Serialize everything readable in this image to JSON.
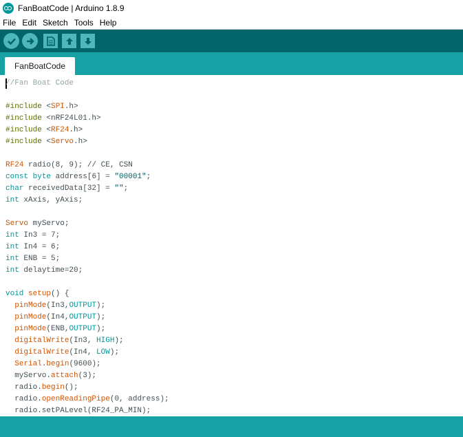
{
  "window": {
    "title": "FanBoatCode | Arduino 1.8.9"
  },
  "menu": [
    "File",
    "Edit",
    "Sketch",
    "Tools",
    "Help"
  ],
  "toolbar": {
    "buttons": [
      "verify",
      "upload",
      "new",
      "open",
      "save"
    ]
  },
  "tabs": [
    {
      "label": "FanBoatCode"
    }
  ],
  "editor": {
    "lines": [
      [
        [
          "//Fan Boat Code",
          "cmt"
        ]
      ],
      [],
      [
        [
          "#include",
          "inc"
        ],
        [
          " <",
          ""
        ],
        [
          "SPI",
          "fn"
        ],
        [
          ".h>",
          ""
        ]
      ],
      [
        [
          "#include",
          "inc"
        ],
        [
          " <nRF24L01.h>",
          ""
        ]
      ],
      [
        [
          "#include",
          "inc"
        ],
        [
          " <",
          ""
        ],
        [
          "RF24",
          "fn"
        ],
        [
          ".h>",
          ""
        ]
      ],
      [
        [
          "#include",
          "inc"
        ],
        [
          " <",
          ""
        ],
        [
          "Servo",
          "fn"
        ],
        [
          ".h>",
          ""
        ]
      ],
      [],
      [
        [
          "RF24",
          "fn"
        ],
        [
          " radio(8, 9); // CE, CSN",
          ""
        ]
      ],
      [
        [
          "const",
          "type"
        ],
        [
          " ",
          ""
        ],
        [
          "byte",
          "type"
        ],
        [
          " address[6] = ",
          ""
        ],
        [
          "\"00001\"",
          "str"
        ],
        [
          ";",
          ""
        ]
      ],
      [
        [
          "char",
          "type"
        ],
        [
          " receivedData[32] = ",
          ""
        ],
        [
          "\"\"",
          "str"
        ],
        [
          ";",
          ""
        ]
      ],
      [
        [
          "int",
          "type"
        ],
        [
          " xAxis, yAxis;",
          ""
        ]
      ],
      [],
      [
        [
          "Servo",
          "fn"
        ],
        [
          " myServo;",
          ""
        ]
      ],
      [
        [
          "int",
          "type"
        ],
        [
          " In3 = 7;",
          ""
        ]
      ],
      [
        [
          "int",
          "type"
        ],
        [
          " In4 = 6;",
          ""
        ]
      ],
      [
        [
          "int",
          "type"
        ],
        [
          " ENB = 5;",
          ""
        ]
      ],
      [
        [
          "int",
          "type"
        ],
        [
          " delaytime=20;",
          ""
        ]
      ],
      [],
      [
        [
          "void",
          "type"
        ],
        [
          " ",
          ""
        ],
        [
          "setup",
          "fn"
        ],
        [
          "() {",
          ""
        ]
      ],
      [
        [
          "  ",
          ""
        ],
        [
          "pinMode",
          "fn"
        ],
        [
          "(In3,",
          ""
        ],
        [
          "OUTPUT",
          "lit"
        ],
        [
          ");",
          ""
        ]
      ],
      [
        [
          "  ",
          ""
        ],
        [
          "pinMode",
          "fn"
        ],
        [
          "(In4,",
          ""
        ],
        [
          "OUTPUT",
          "lit"
        ],
        [
          ");",
          ""
        ]
      ],
      [
        [
          "  ",
          ""
        ],
        [
          "pinMode",
          "fn"
        ],
        [
          "(ENB,",
          ""
        ],
        [
          "OUTPUT",
          "lit"
        ],
        [
          ");",
          ""
        ]
      ],
      [
        [
          "  ",
          ""
        ],
        [
          "digitalWrite",
          "fn"
        ],
        [
          "(In3, ",
          ""
        ],
        [
          "HIGH",
          "lit"
        ],
        [
          ");",
          ""
        ]
      ],
      [
        [
          "  ",
          ""
        ],
        [
          "digitalWrite",
          "fn"
        ],
        [
          "(In4, ",
          ""
        ],
        [
          "LOW",
          "lit"
        ],
        [
          ");",
          ""
        ]
      ],
      [
        [
          "  ",
          ""
        ],
        [
          "Serial",
          "fn"
        ],
        [
          ".",
          ""
        ],
        [
          "begin",
          "fn"
        ],
        [
          "(9600);",
          ""
        ]
      ],
      [
        [
          "  myServo.",
          ""
        ],
        [
          "attach",
          "fn"
        ],
        [
          "(3);",
          ""
        ]
      ],
      [
        [
          "  radio.",
          ""
        ],
        [
          "begin",
          "fn"
        ],
        [
          "();",
          ""
        ]
      ],
      [
        [
          "  radio.",
          ""
        ],
        [
          "openReadingPipe",
          "fn"
        ],
        [
          "(0, address);",
          ""
        ]
      ],
      [
        [
          "  radio.setPALevel(RF24_PA_MIN);",
          ""
        ]
      ]
    ]
  },
  "colors": {
    "toolbar": "#006468",
    "tabbar": "#17a1a5",
    "button": "#4db7bb"
  }
}
